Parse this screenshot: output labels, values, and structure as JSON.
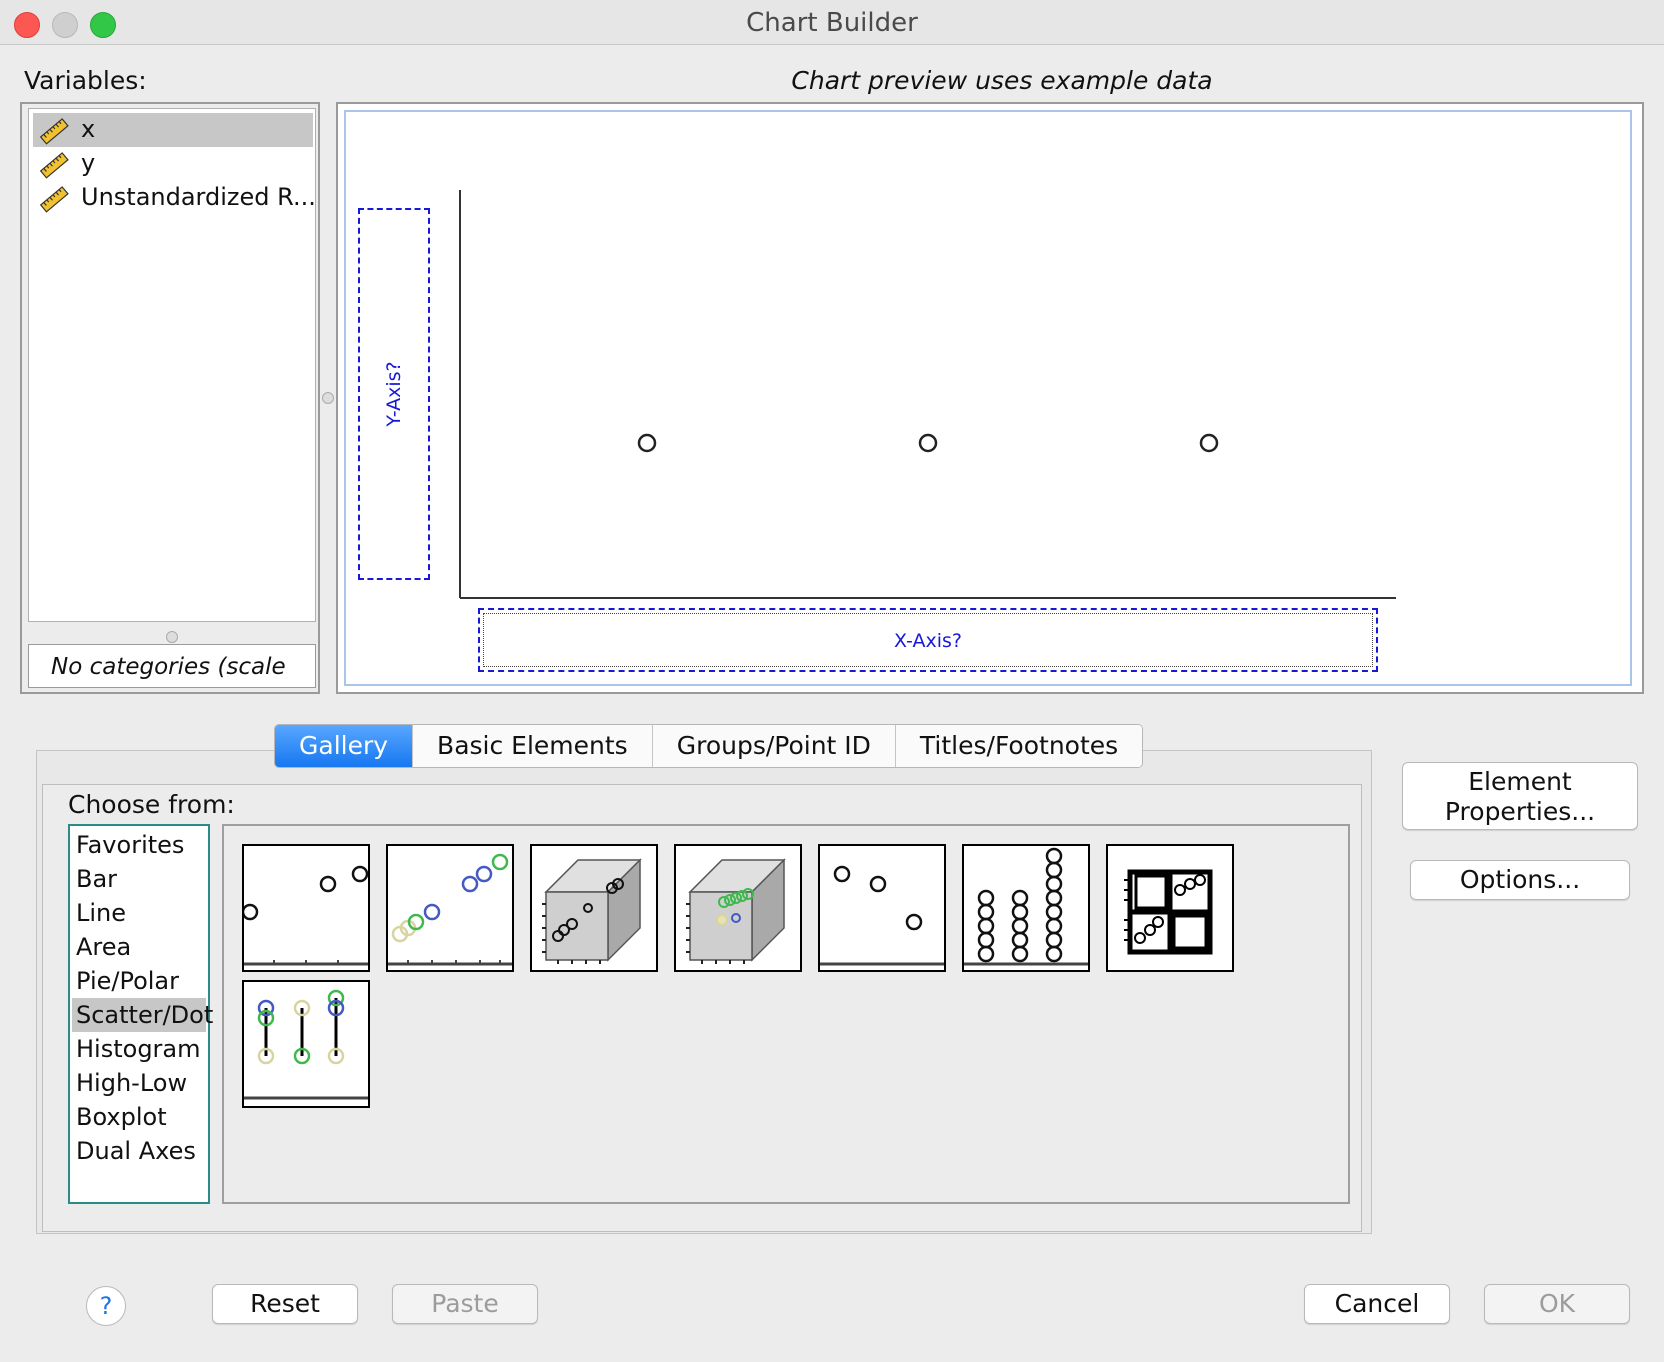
{
  "window": {
    "title": "Chart Builder"
  },
  "variables": {
    "label": "Variables:",
    "items": [
      {
        "name": "x",
        "icon": "ruler-scale-icon",
        "selected": true
      },
      {
        "name": "y",
        "icon": "ruler-scale-icon",
        "selected": false
      },
      {
        "name": "Unstandardized R...",
        "icon": "ruler-scale-icon",
        "selected": false
      }
    ],
    "categories_note": "No categories (scale"
  },
  "preview": {
    "note": "Chart preview uses example data",
    "y_axis_drop": "Y-Axis?",
    "x_axis_drop": "X-Axis?"
  },
  "tabs": [
    {
      "label": "Gallery",
      "active": true
    },
    {
      "label": "Basic Elements",
      "active": false
    },
    {
      "label": "Groups/Point ID",
      "active": false
    },
    {
      "label": "Titles/Footnotes",
      "active": false
    }
  ],
  "gallery": {
    "choose_label": "Choose from:",
    "chart_types": [
      "Favorites",
      "Bar",
      "Line",
      "Area",
      "Pie/Polar",
      "Scatter/Dot",
      "Histogram",
      "High-Low",
      "Boxplot",
      "Dual Axes"
    ],
    "selected_type": "Scatter/Dot",
    "thumbnails": [
      "simple-scatter-icon",
      "grouped-scatter-icon",
      "simple-3d-scatter-icon",
      "grouped-3d-scatter-icon",
      "summary-point-plot-icon",
      "simple-dot-plot-icon",
      "scatterplot-matrix-icon",
      "drop-line-icon"
    ]
  },
  "side_buttons": {
    "element_properties": [
      "Element",
      "Properties..."
    ],
    "options": "Options..."
  },
  "footer": {
    "help": "?",
    "reset": "Reset",
    "paste": "Paste",
    "cancel": "Cancel",
    "ok": "OK"
  },
  "colors": {
    "accent_blue": "#1677f0",
    "drop_zone_blue": "#1818d8",
    "list_border_teal": "#2d8a88",
    "selection_gray": "#c7c7c7"
  }
}
